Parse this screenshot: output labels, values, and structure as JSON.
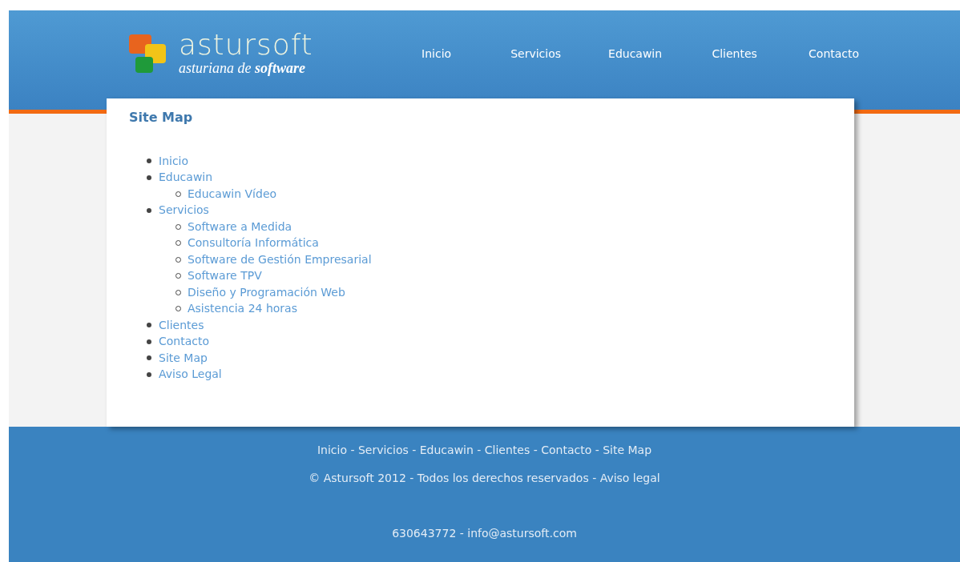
{
  "header": {
    "logo": {
      "name": "astursoft",
      "tagline": "asturiana de **software**"
    },
    "nav": [
      {
        "label": "Inicio"
      },
      {
        "label": "Servicios"
      },
      {
        "label": "Educawin"
      },
      {
        "label": "Clientes"
      },
      {
        "label": "Contacto"
      }
    ]
  },
  "content": {
    "title": "Site Map",
    "sitemap": [
      {
        "label": "Inicio"
      },
      {
        "label": "Educawin",
        "children": [
          {
            "label": "Educawin Vídeo"
          }
        ]
      },
      {
        "label": "Servicios",
        "children": [
          {
            "label": "Software a Medida"
          },
          {
            "label": "Consultoría Informática"
          },
          {
            "label": "Software de Gestión Empresarial"
          },
          {
            "label": "Software TPV"
          },
          {
            "label": "Diseño y Programación Web"
          },
          {
            "label": "Asistencia 24 horas"
          }
        ]
      },
      {
        "label": "Clientes"
      },
      {
        "label": "Contacto"
      },
      {
        "label": "Site Map"
      },
      {
        "label": "Aviso Legal"
      }
    ]
  },
  "footer": {
    "links": "Inicio - Servicios - Educawin - Clientes - Contacto - Site Map",
    "copyright": "© Astursoft 2012 - Todos los derechos reservados - Aviso legal",
    "contact": "630643772 - info@astursoft.com"
  }
}
